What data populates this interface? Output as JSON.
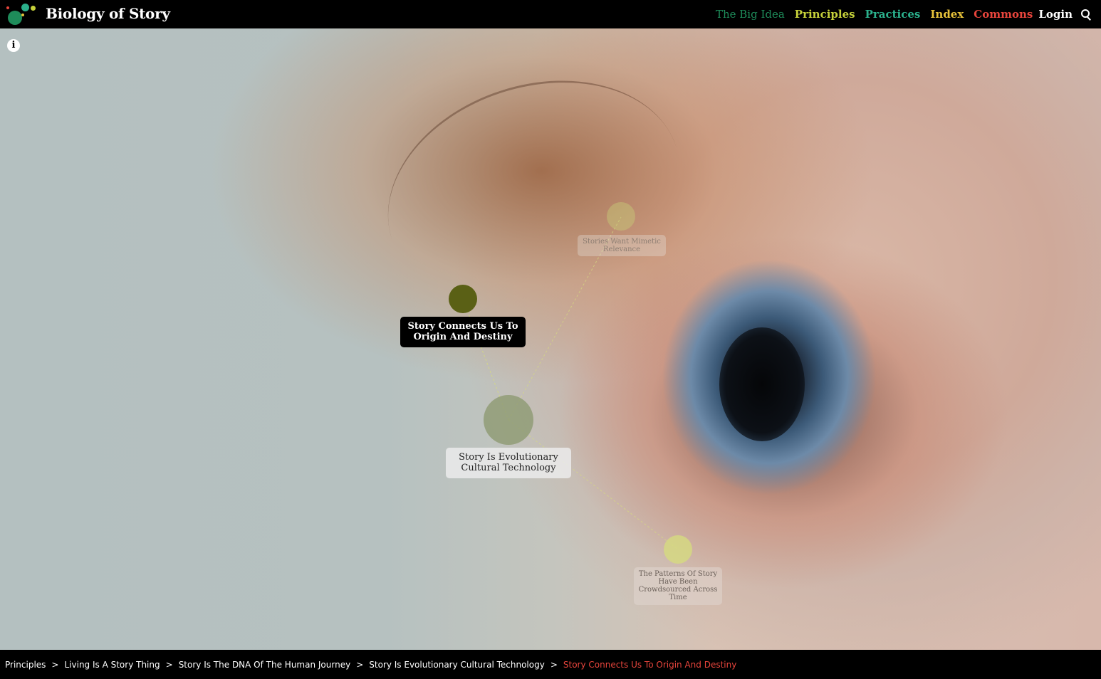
{
  "header": {
    "brand": "Biology of Story",
    "nav": [
      {
        "label": "The Big Idea",
        "color": "#1e8c5a"
      },
      {
        "label": "Principles",
        "color": "#c6d13a"
      },
      {
        "label": "Practices",
        "color": "#2bb08c"
      },
      {
        "label": "Index",
        "color": "#e7c23a"
      },
      {
        "label": "Commons",
        "color": "#e8453c"
      },
      {
        "label": "Login",
        "color": "#ffffff"
      }
    ]
  },
  "graph": {
    "nodes": [
      {
        "label": "Stories Want Mimetic Relevance",
        "role": "related"
      },
      {
        "label": "Story Connects Us To Origin And Destiny",
        "role": "current"
      },
      {
        "label": "Story Is Evolutionary Cultural Technology",
        "role": "parent"
      },
      {
        "label": "The Patterns Of Story Have Been Crowdsourced Across Time",
        "role": "related"
      }
    ]
  },
  "breadcrumb": [
    "Principles",
    "Living Is A Story Thing",
    "Story Is The DNA Of The Human Journey",
    "Story Is Evolutionary Cultural Technology",
    "Story Connects Us To Origin And Destiny"
  ],
  "breadcrumb_separator": ">",
  "colors": {
    "current_crumb": "#e8453c",
    "node_current": "#5a6015",
    "node_parent": "#8d9a72",
    "node_related_light": "#d6db80"
  }
}
